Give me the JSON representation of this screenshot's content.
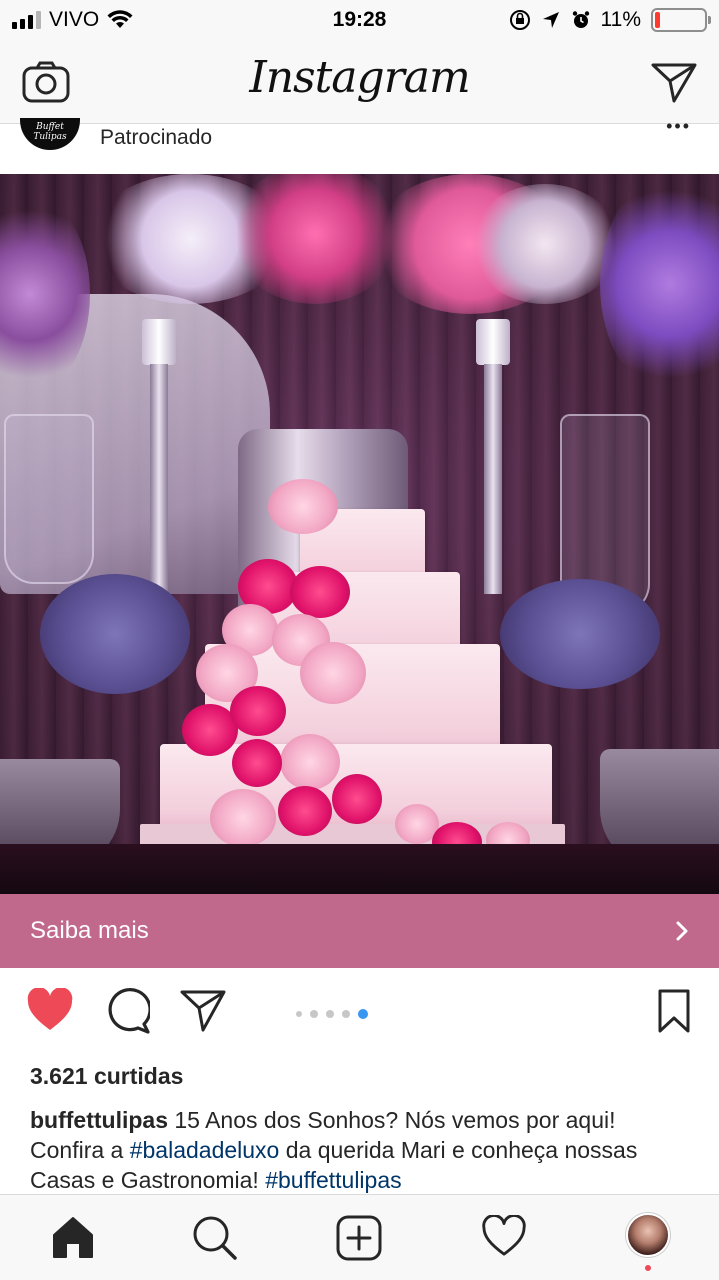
{
  "status_bar": {
    "carrier": "VIVO",
    "time": "19:28",
    "battery_percent": "11%",
    "battery_level": 0.11
  },
  "header": {
    "title": "Instagram",
    "camera_icon": "camera-icon",
    "direct_icon": "paper-plane-icon"
  },
  "post": {
    "account_logo_text": "Buffet Tulipas",
    "sponsored_label": "Patrocinado",
    "cta_label": "Saiba mais",
    "carousel": {
      "count": 5,
      "active_index": 4
    },
    "likes": "3.621 curtidas",
    "caption": {
      "username": "buffettulipas",
      "text_1": " 15 Anos dos Sonhos? Nós vemos por aqui! Confira a ",
      "hashtag_1": "#baladadeluxo",
      "text_2": " da querida Mari e conheça nossas Casas e Gastronomia! ",
      "hashtag_2": "#buffettulipas"
    }
  },
  "tab_bar": {
    "items": [
      "home-icon",
      "search-icon",
      "add-post-icon",
      "heart-icon",
      "profile-avatar"
    ]
  },
  "colors": {
    "cta_background": "#c0698d",
    "like_red": "#ed4956",
    "hashtag_blue": "#003569",
    "carousel_active": "#3897f0"
  }
}
